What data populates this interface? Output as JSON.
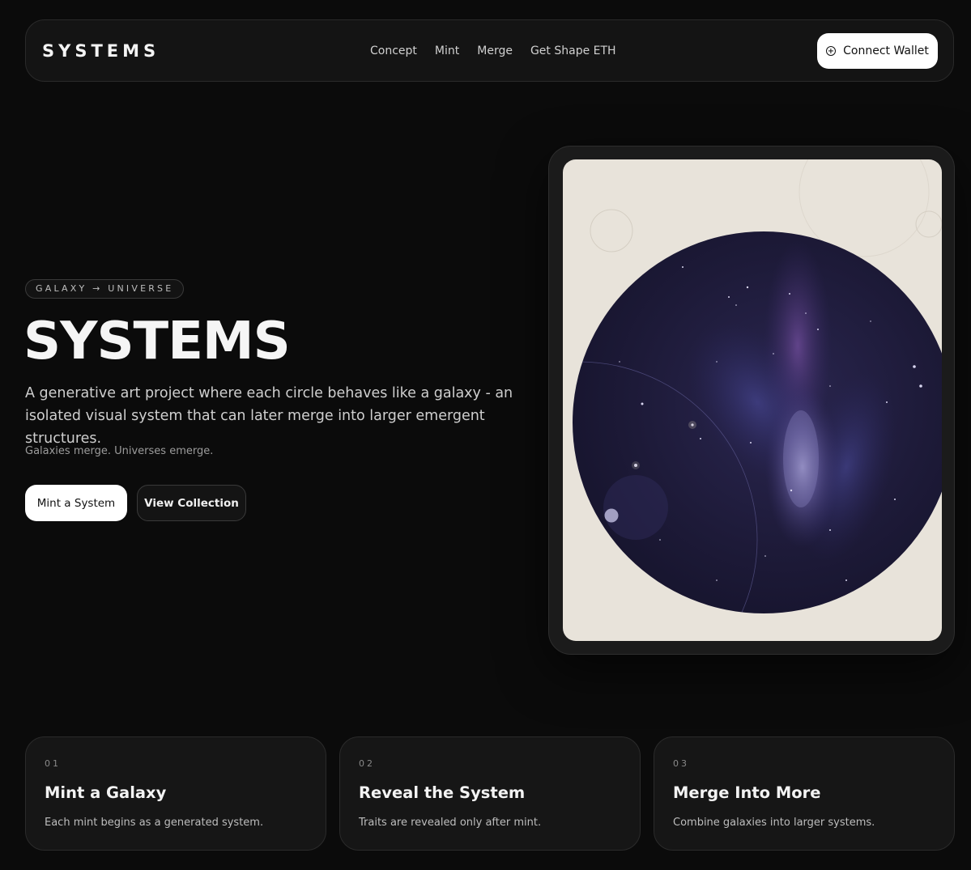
{
  "nav": {
    "logo": "SYSTEMS",
    "links": [
      "Concept",
      "Mint",
      "Merge",
      "Get Shape ETH"
    ],
    "connect_label": "Connect Wallet",
    "connect_icon": "plus-circle-icon"
  },
  "hero": {
    "tag": "GALAXY → UNIVERSE",
    "title": "SYSTEMS",
    "description": "A generative art project where each circle behaves like a galaxy - an isolated visual system that can later merge into larger emergent structures.",
    "subtitle": "Galaxies merge. Universes emerge.",
    "primary_button": "Mint a System",
    "secondary_button": "View Collection"
  },
  "artwork": {
    "background_color": "#e8e3da",
    "galaxy_color": "#1f1c3a"
  },
  "features": [
    {
      "number": "01",
      "title": "Mint a Galaxy",
      "description": "Each mint begins as a generated system."
    },
    {
      "number": "02",
      "title": "Reveal the System",
      "description": "Traits are revealed only after mint."
    },
    {
      "number": "03",
      "title": "Merge Into More",
      "description": "Combine galaxies into larger systems."
    }
  ]
}
